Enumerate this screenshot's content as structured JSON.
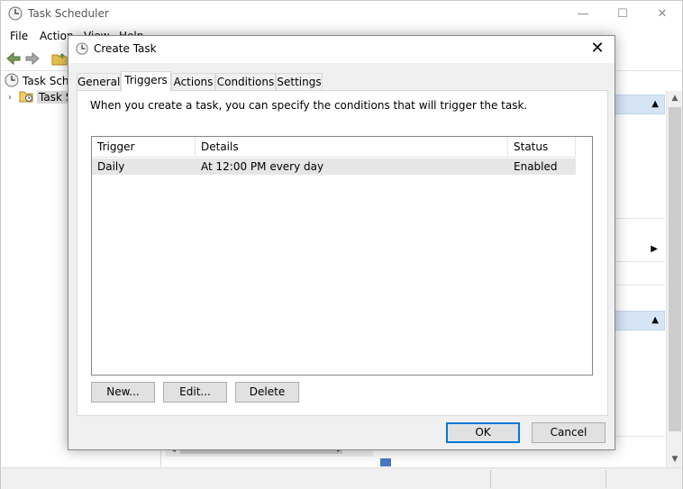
{
  "main_window": {
    "title": "Task Scheduler",
    "menu": [
      "File",
      "Action",
      "View",
      "Help"
    ],
    "tree": [
      {
        "label": "Task Scheduler (Local)"
      },
      {
        "label": "Task Scheduler Library"
      }
    ]
  },
  "dialog": {
    "title": "Create Task",
    "close_label": "✕",
    "tabs": [
      {
        "label": "General",
        "active": false
      },
      {
        "label": "Triggers",
        "active": true
      },
      {
        "label": "Actions",
        "active": false
      },
      {
        "label": "Conditions",
        "active": false
      },
      {
        "label": "Settings",
        "active": false
      }
    ],
    "description": "When you create a task, you can specify the conditions that will trigger the task.",
    "grid": {
      "columns": [
        "Trigger",
        "Details",
        "Status"
      ],
      "rows": [
        {
          "trigger": "Daily",
          "details": "At 12:00 PM every day",
          "status": "Enabled"
        }
      ]
    },
    "buttons": {
      "new": "New...",
      "edit": "Edit...",
      "delete": "Delete",
      "ok": "OK",
      "cancel": "Cancel"
    }
  },
  "colors": {
    "accent": "#0078d7",
    "selected_row": "#e6e6e6",
    "action_header": "#d6e5f5"
  }
}
